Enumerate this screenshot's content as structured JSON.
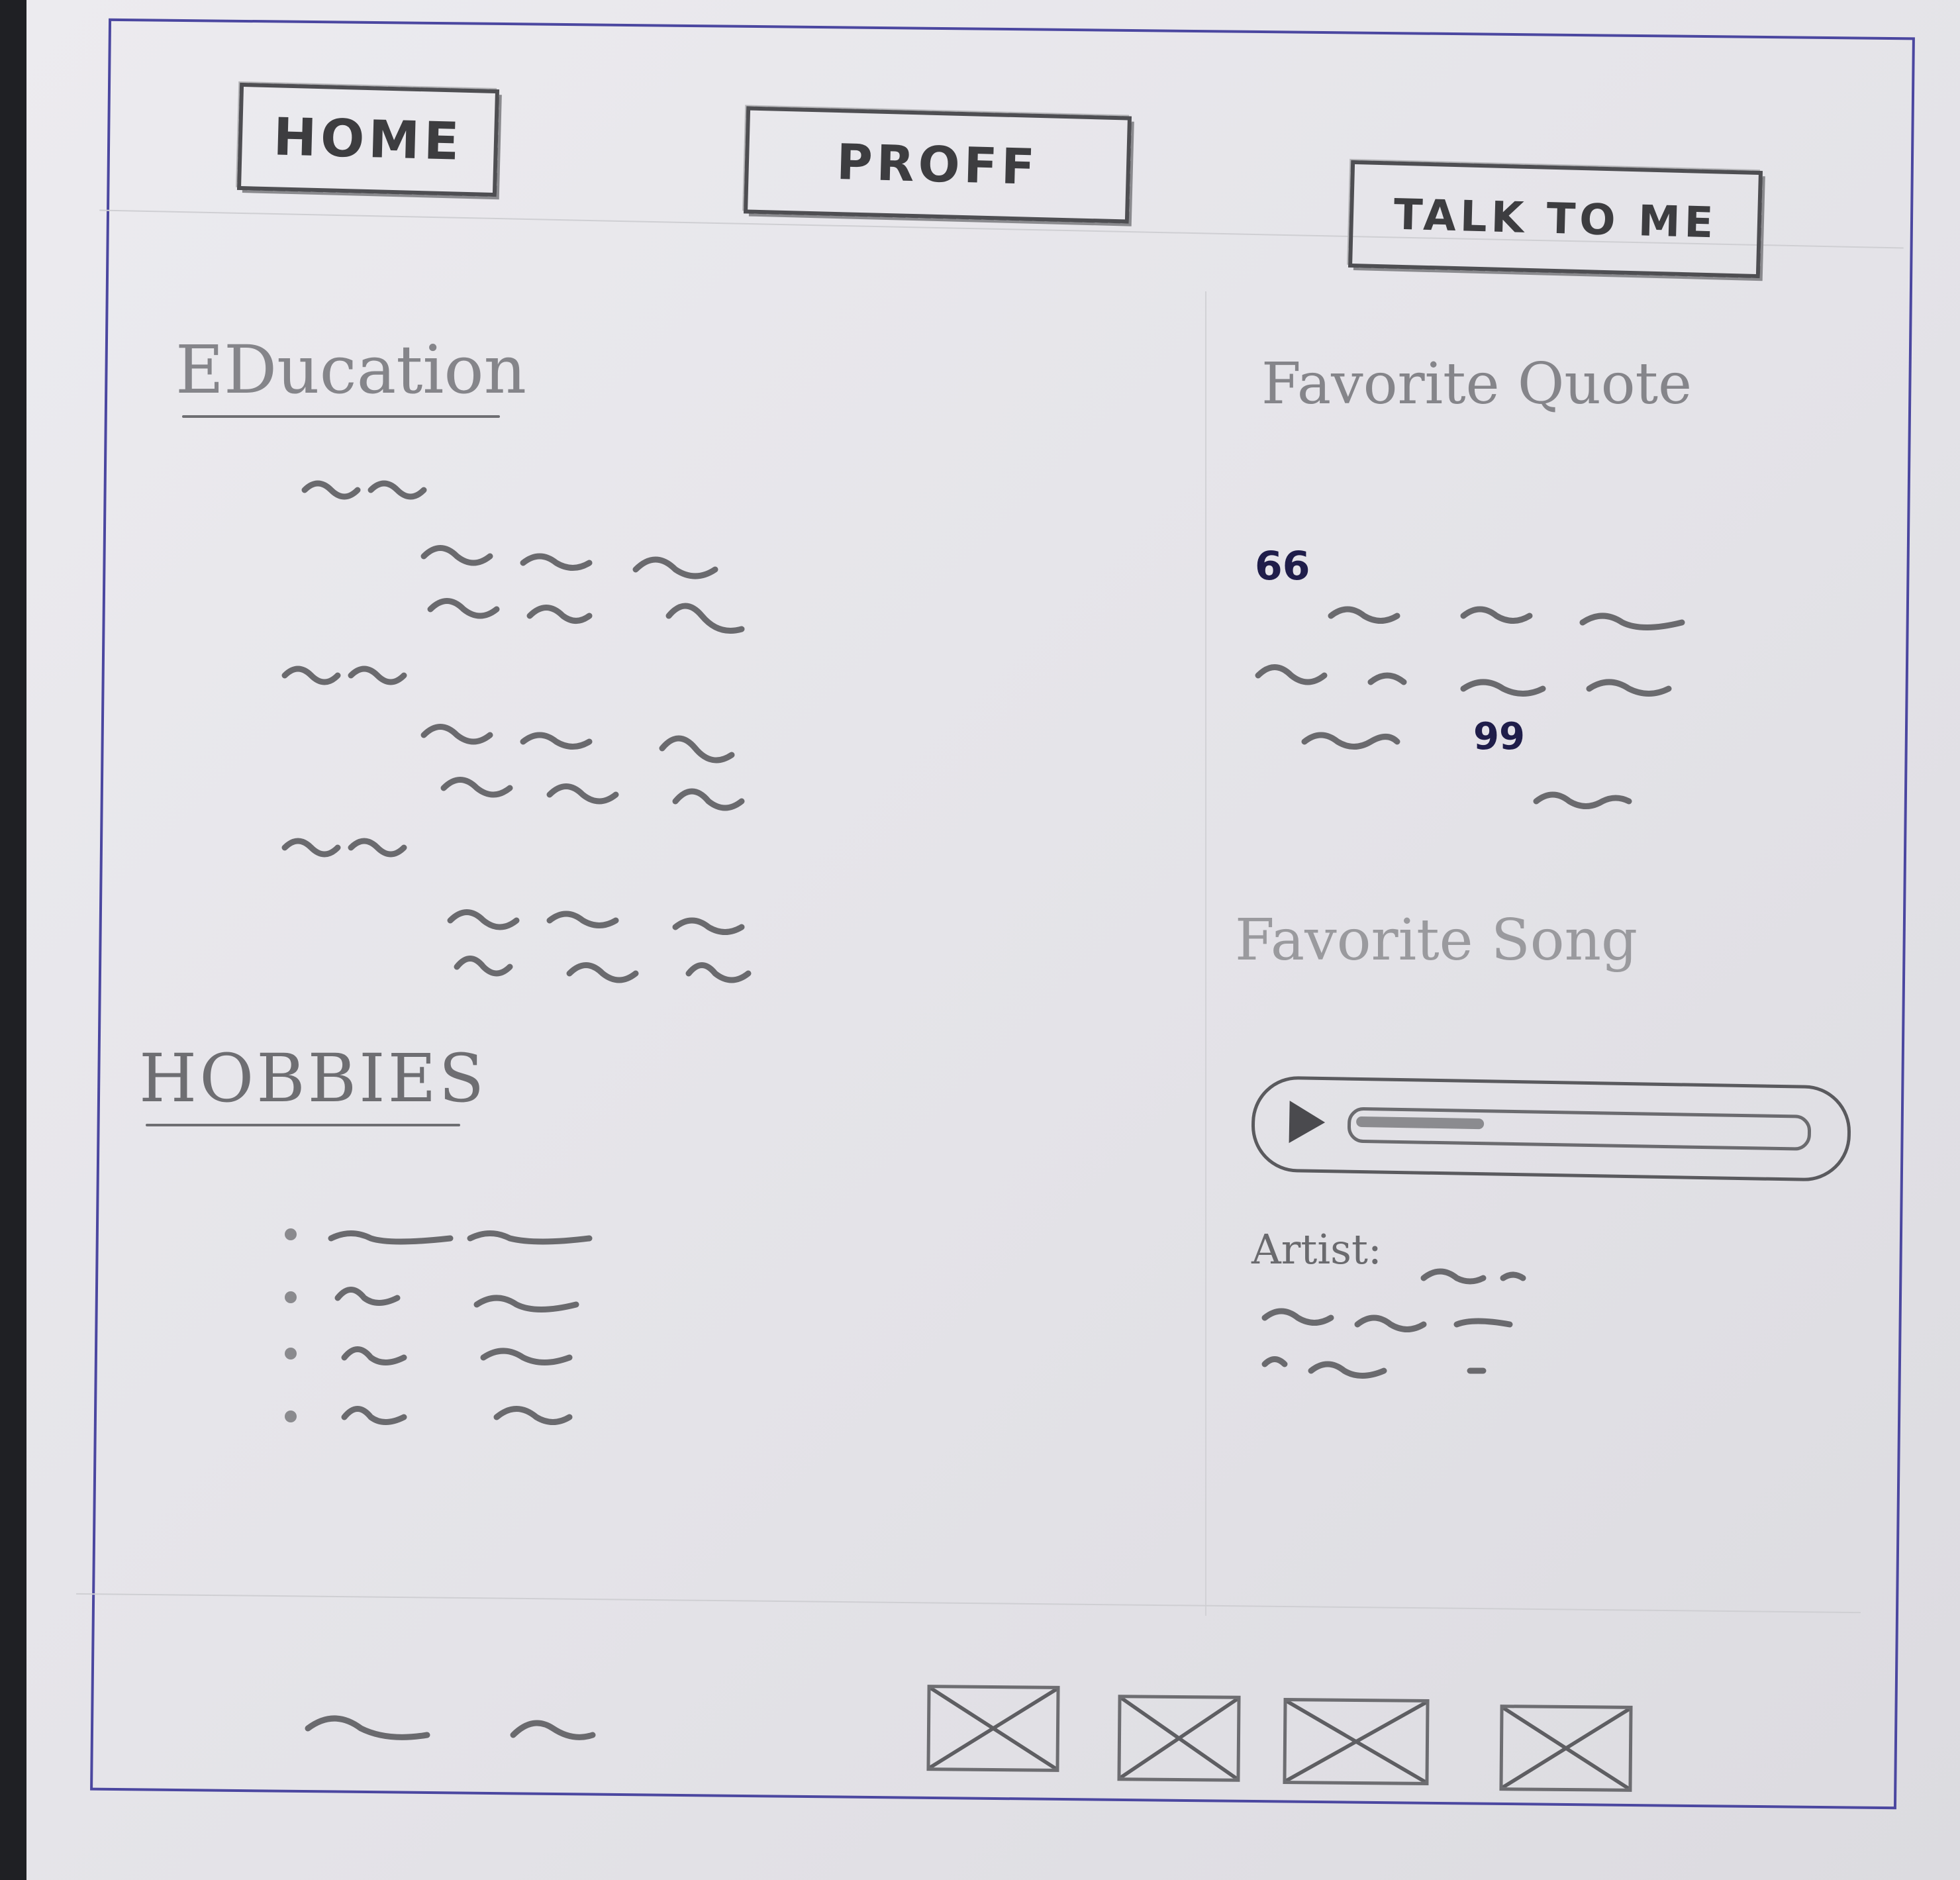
{
  "nav": {
    "home": "HOME",
    "prof": "PROFF",
    "talk": "TALK TO ME"
  },
  "sections": {
    "education": "EDucation",
    "hobbies": "HOBBIES",
    "quote": "Favorite Quote",
    "song": "Favorite Song"
  },
  "quote_marks": {
    "open": "66",
    "close": "99"
  },
  "player": {
    "progress": 0.29
  },
  "song_meta": {
    "artist_label": "Artist:"
  },
  "icons": {
    "play": "play-icon",
    "image_placeholder": "image-placeholder-icon"
  },
  "colors": {
    "frame": "#4b47a0",
    "pencil": "#4e4e52",
    "paper": "#e8e7ec"
  }
}
